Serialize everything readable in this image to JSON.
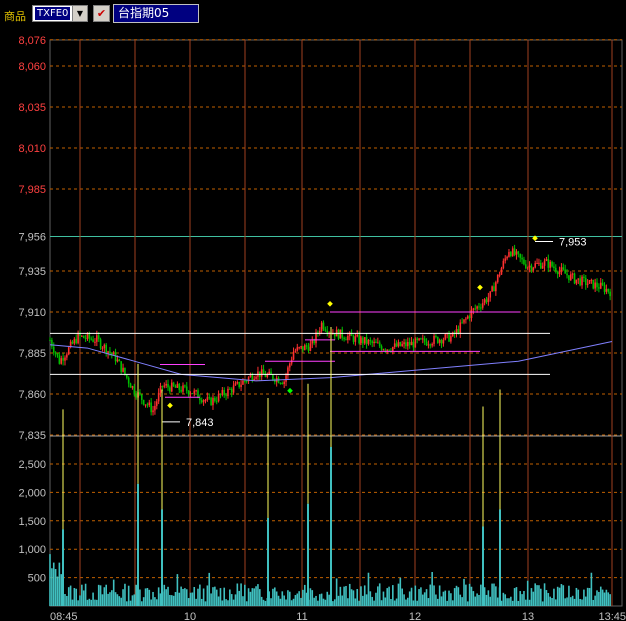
{
  "toolbar": {
    "product_label": "商品",
    "symbol_value": "TXFE0",
    "dropdown_icon": "chevron-down-icon",
    "check_icon": "checkbox-checked-icon",
    "chart_title": "台指期05"
  },
  "chart_data": {
    "type": "candlestick",
    "price_axis_ticks": [
      "8,076",
      "8,060",
      "8,035",
      "8,010",
      "7,985",
      "7,956",
      "7,935",
      "7,910",
      "7,885",
      "7,860",
      "7,835"
    ],
    "volume_axis_ticks": [
      "2,500",
      "2,000",
      "1,500",
      "1,000",
      "500"
    ],
    "time_axis_ticks": [
      "08:45",
      "10",
      "11",
      "12",
      "13",
      "13:45"
    ],
    "annotations": [
      {
        "text": "7,953",
        "price": 7953
      },
      {
        "text": "7,843",
        "price": 7843
      }
    ],
    "colors": {
      "up_candle": "#ff3030",
      "down_candle": "#00c000",
      "volume": "#40c0c0",
      "moving_average": "#8080ff",
      "support_resistance": "#ffffff",
      "pivot_lines": "#ff40ff",
      "volume_spikes": "#ffff60",
      "grid_h": "#c06000",
      "grid_v": "#a04020",
      "axis_price_upper": "#ff4040",
      "axis_price_lower": "#c0c0c0",
      "high_line": "#40c0a0"
    }
  }
}
